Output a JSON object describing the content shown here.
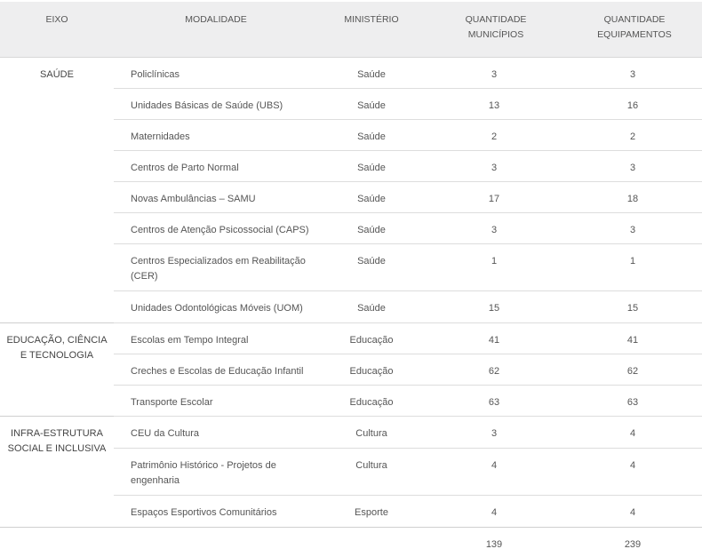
{
  "headers": {
    "eixo": "EIXO",
    "modalidade": "MODALIDADE",
    "ministerio": "MINISTÉRIO",
    "qtd_municipios_l1": "QUANTIDADE",
    "qtd_municipios_l2": "MUNICÍPIOS",
    "qtd_equipamentos_l1": "QUANTIDADE",
    "qtd_equipamentos_l2": "EQUIPAMENTOS"
  },
  "groups": [
    {
      "eixo": "SAÚDE",
      "rows": [
        {
          "modalidade": "Policlínicas",
          "ministerio": "Saúde",
          "municipios": "3",
          "equipamentos": "3"
        },
        {
          "modalidade": "Unidades Básicas de Saúde (UBS)",
          "ministerio": "Saúde",
          "municipios": "13",
          "equipamentos": "16"
        },
        {
          "modalidade": "Maternidades",
          "ministerio": "Saúde",
          "municipios": "2",
          "equipamentos": "2"
        },
        {
          "modalidade": "Centros de Parto Normal",
          "ministerio": "Saúde",
          "municipios": "3",
          "equipamentos": "3"
        },
        {
          "modalidade": "Novas Ambulâncias – SAMU",
          "ministerio": "Saúde",
          "municipios": "17",
          "equipamentos": "18"
        },
        {
          "modalidade": "Centros de Atenção Psicossocial (CAPS)",
          "ministerio": "Saúde",
          "municipios": "3",
          "equipamentos": "3"
        },
        {
          "modalidade": "Centros Especializados em Reabilitação (CER)",
          "ministerio": "Saúde",
          "municipios": "1",
          "equipamentos": "1"
        },
        {
          "modalidade": "Unidades Odontológicas Móveis (UOM)",
          "ministerio": "Saúde",
          "municipios": "15",
          "equipamentos": "15"
        }
      ]
    },
    {
      "eixo": "EDUCAÇÃO, CIÊNCIA E TECNOLOGIA",
      "rows": [
        {
          "modalidade": "Escolas em Tempo Integral",
          "ministerio": "Educação",
          "municipios": "41",
          "equipamentos": "41"
        },
        {
          "modalidade": "Creches e Escolas de Educação Infantil",
          "ministerio": "Educação",
          "municipios": "62",
          "equipamentos": "62"
        },
        {
          "modalidade": "Transporte Escolar",
          "ministerio": "Educação",
          "municipios": "63",
          "equipamentos": "63"
        }
      ]
    },
    {
      "eixo": "INFRA-ESTRUTURA SOCIAL E INCLUSIVA",
      "rows": [
        {
          "modalidade": "CEU da Cultura",
          "ministerio": "Cultura",
          "municipios": "3",
          "equipamentos": "4"
        },
        {
          "modalidade": "Patrimônio Histórico - Projetos de engenharia",
          "ministerio": "Cultura",
          "municipios": "4",
          "equipamentos": "4"
        },
        {
          "modalidade": "Espaços Esportivos Comunitários",
          "ministerio": "Esporte",
          "municipios": "4",
          "equipamentos": "4"
        }
      ]
    }
  ],
  "totals": {
    "municipios": "139",
    "equipamentos": "239"
  }
}
